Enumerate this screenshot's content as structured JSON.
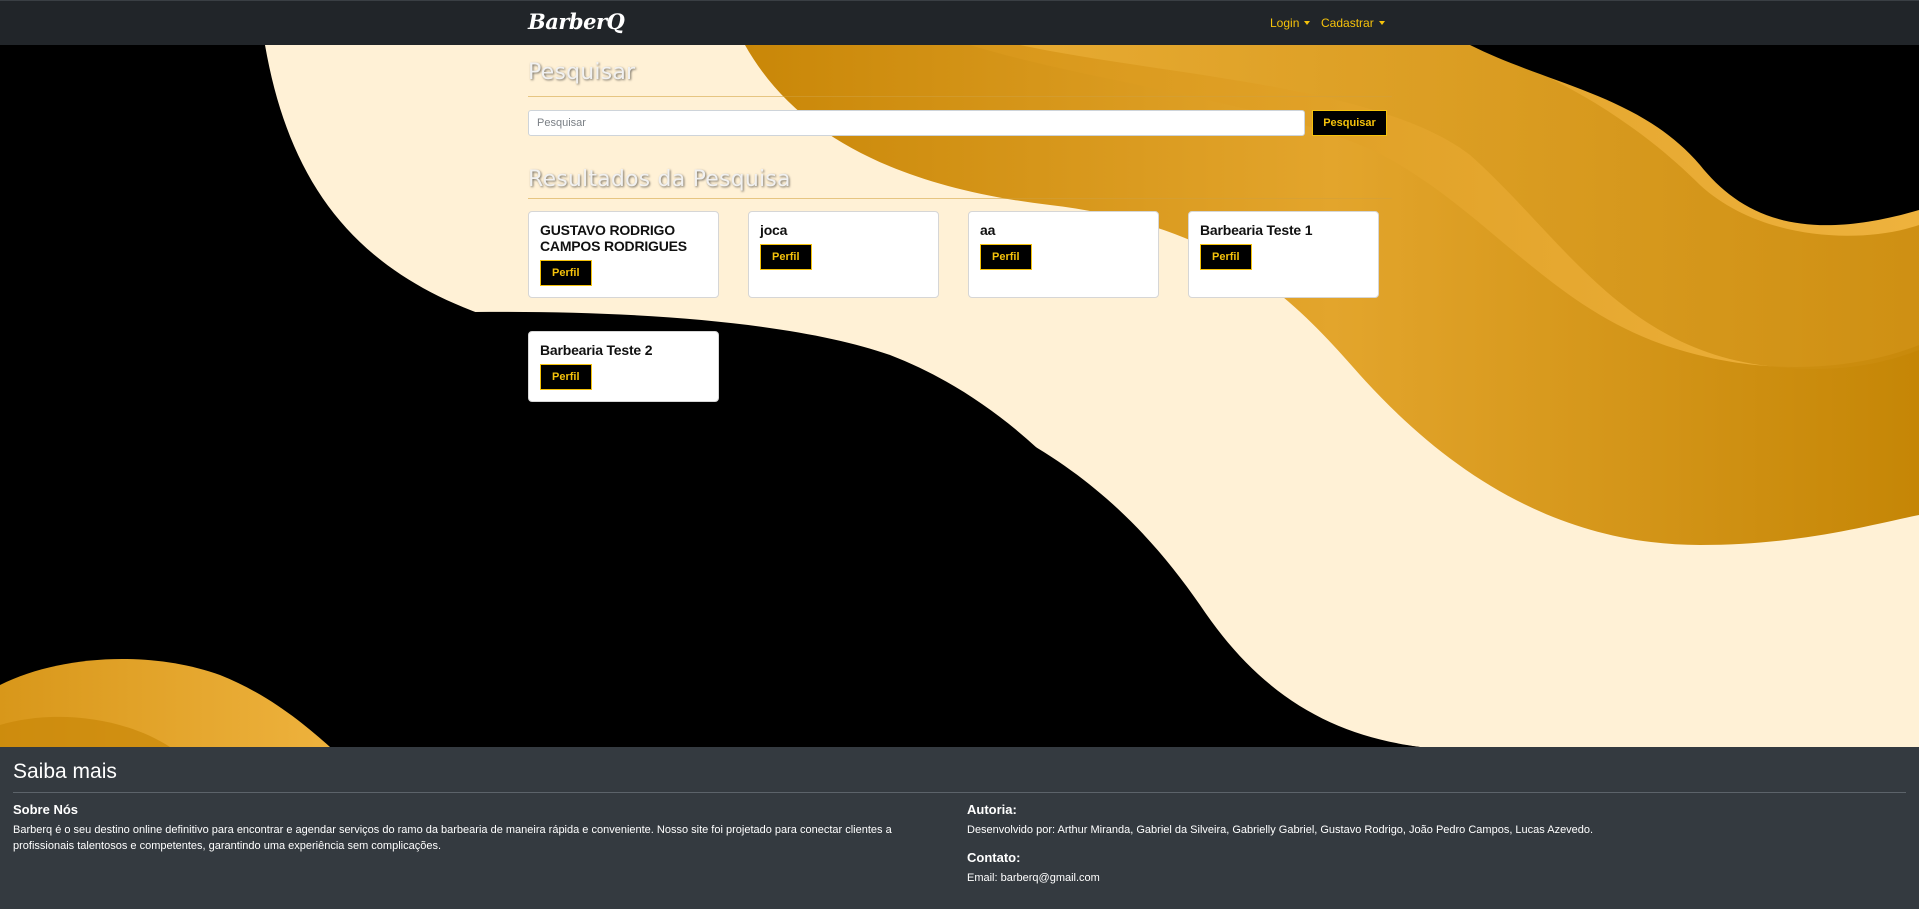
{
  "navbar": {
    "brand": "BarberQ",
    "login_label": "Login",
    "register_label": "Cadastrar"
  },
  "search": {
    "heading": "Pesquisar",
    "placeholder": "Pesquisar",
    "button_label": "Pesquisar"
  },
  "results": {
    "heading": "Resultados da Pesquisa",
    "button_label": "Perfil",
    "items": [
      {
        "name": "GUSTAVO RODRIGO CAMPOS RODRIGUES"
      },
      {
        "name": "joca"
      },
      {
        "name": "aa"
      },
      {
        "name": "Barbearia Teste 1"
      },
      {
        "name": "Barbearia Teste 2"
      }
    ]
  },
  "footer": {
    "title": "Saiba mais",
    "about_heading": "Sobre Nós",
    "about_text": "Barberq é o seu destino online definitivo para encontrar e agendar serviços do ramo da barbearia de maneira rápida e conveniente. Nosso site foi projetado para conectar clientes a profissionais talentosos e competentes, garantindo uma experiência sem complicações.",
    "authors_heading": "Autoria:",
    "authors_text": "Desenvolvido por: Arthur Miranda, Gabriel da Silveira, Gabrielly Gabriel, Gustavo Rodrigo, João Pedro Campos, Lucas Azevedo.",
    "contact_heading": "Contato:",
    "contact_text": "Email: barberq@gmail.com"
  },
  "colors": {
    "accent": "#f5c20b",
    "navbar_bg": "#212529",
    "footer_bg": "#343a40",
    "cream": "#fff1d6",
    "gold_dark": "#c88a0a",
    "gold_light": "#eab13a"
  }
}
